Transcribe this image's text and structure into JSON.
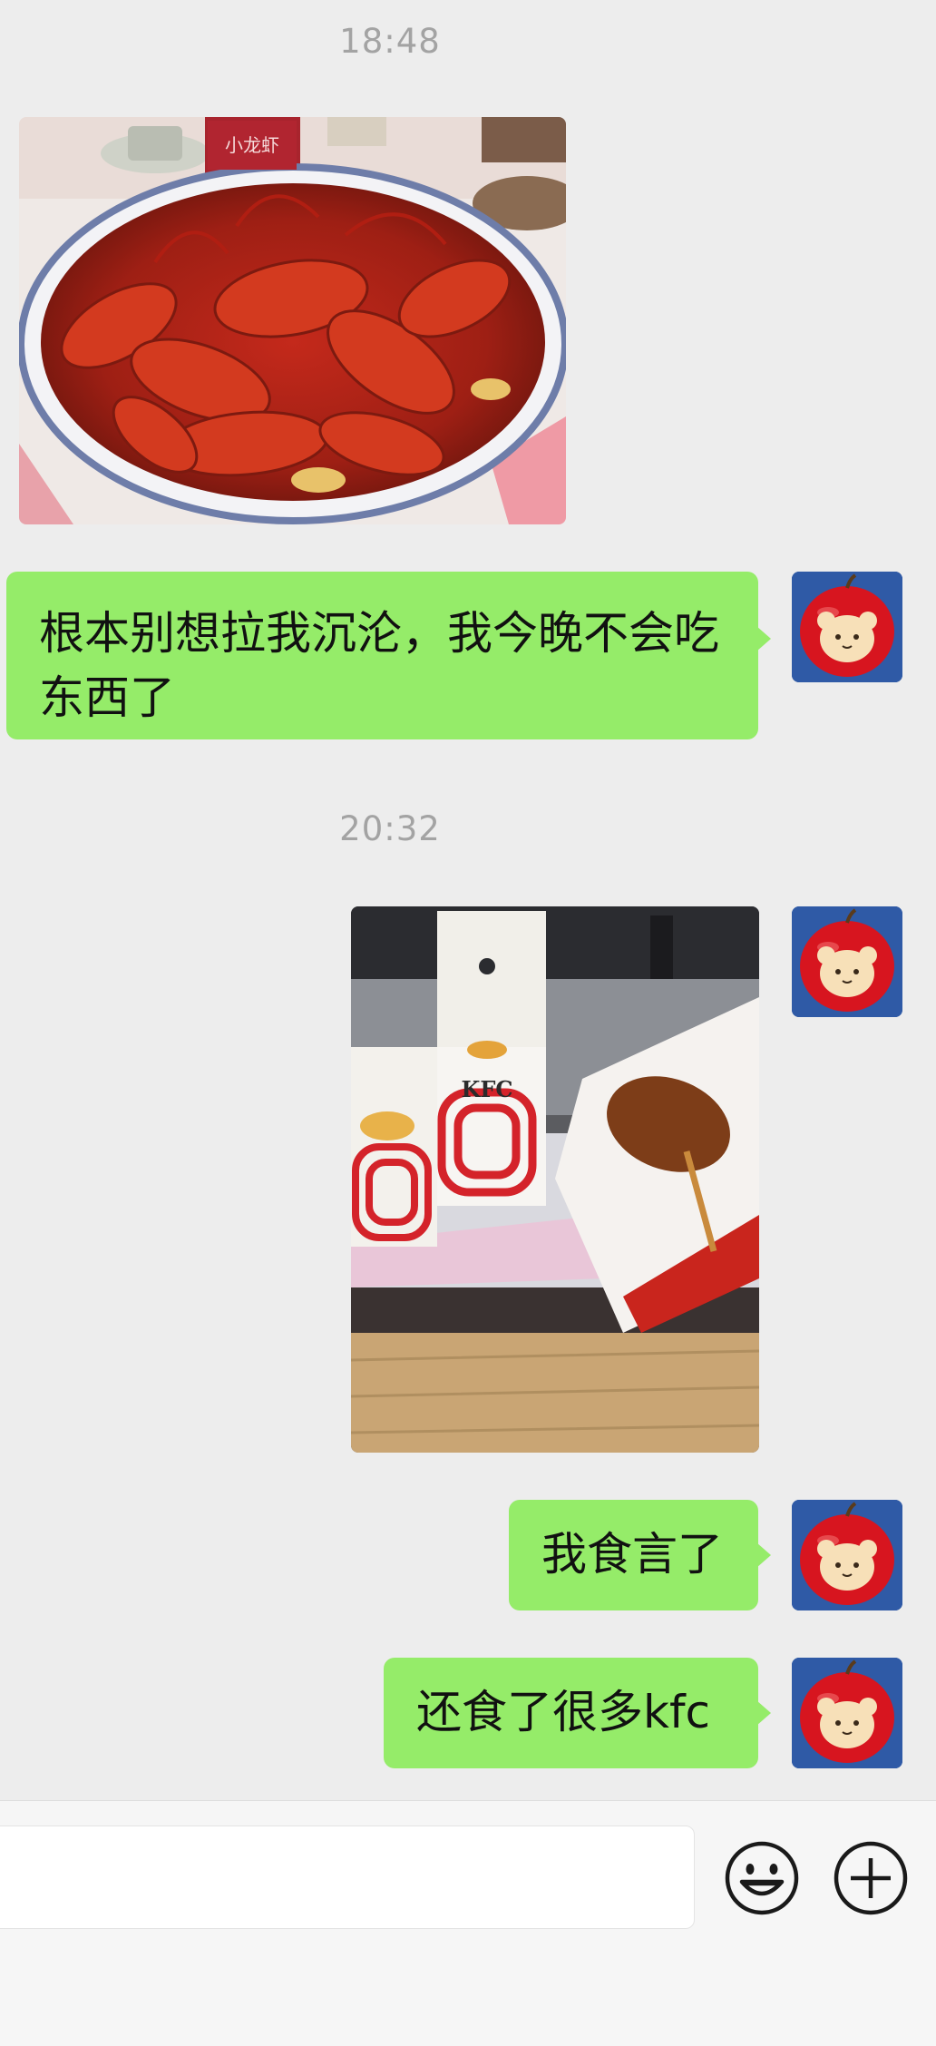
{
  "chat": {
    "timestamp_1": "18:48",
    "timestamp_2": "20:32",
    "messages": [
      {
        "type": "text",
        "text": "根本别想拉我沉沦，我今晚不会吃东西了",
        "line1": "根本别想拉我沉沦，我今晚不会吃",
        "line2": "东西了"
      },
      {
        "type": "text",
        "text": "我食言了"
      },
      {
        "type": "text",
        "text": "还食了很多kfc"
      }
    ]
  },
  "photos": {
    "crayfish": {
      "sign_text": "小龙虾"
    },
    "kfc": {
      "logo_text": "KFC"
    }
  },
  "colors": {
    "background": "#ededed",
    "bubble_green": "#95ec69",
    "avatar_bg": "#2f5aa6",
    "timestamp_gray": "#a3a3a3"
  },
  "icons": {
    "emoji_button": "smiley-icon",
    "more_button": "plus-circle-icon"
  }
}
